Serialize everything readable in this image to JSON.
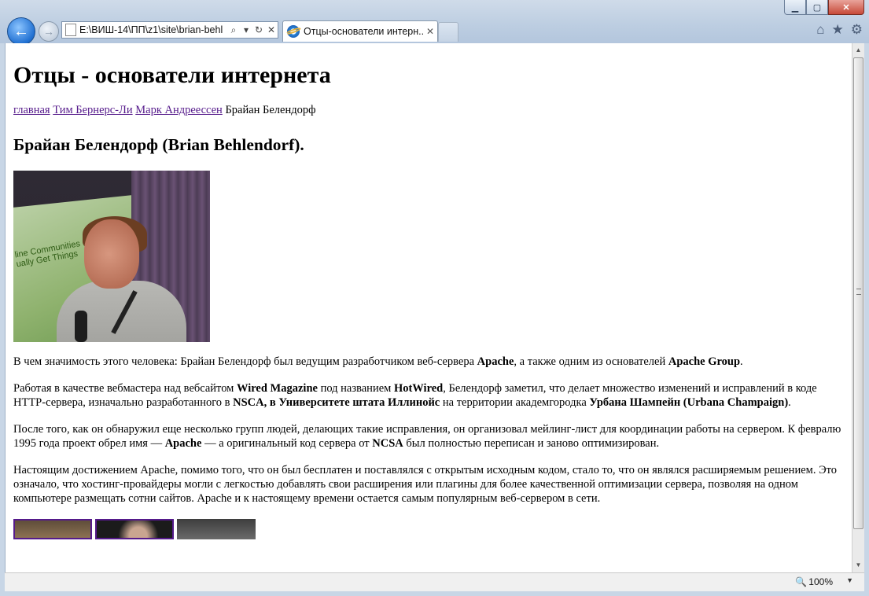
{
  "window": {
    "minimize_label": "▁",
    "maximize_label": "▢",
    "close_label": "✕"
  },
  "toolbar": {
    "back_icon": "back-arrow-icon",
    "forward_icon": "forward-arrow-icon",
    "address": "E:\\ВИШ-14\\ПП\\z1\\site\\brian-behl",
    "search_glyph": "⌕",
    "dropdown_glyph": "▾",
    "refresh_glyph": "↻",
    "stop_glyph": "✕"
  },
  "tab": {
    "title": "Отцы-основатели интерн...",
    "close_label": "✕"
  },
  "right_icons": {
    "home": "⌂",
    "favorites": "★",
    "tools": "⚙"
  },
  "page": {
    "title": "Отцы - основатели интернета",
    "nav": {
      "link1": "главная",
      "link2": "Тим Бернерс-Ли",
      "link3": "Марк Андреессен",
      "current": "Брайан Белендорф"
    },
    "subtitle": "Брайан Белендорф (Brian Behlendorf).",
    "slide_text": "line Communities\nually Get Things",
    "p1": {
      "a": "В чем значимость этого человека: Брайан Белендорф был ведущим разработчиком веб-сервера ",
      "b1": "Apache",
      "c": ", а также одним из основателей ",
      "b2": "Apache Group",
      "d": "."
    },
    "p2": {
      "a": "Работая в качестве вебмастера над вебсайтом ",
      "b1": "Wired Magazine",
      "c": " под названием ",
      "b2": "HotWired",
      "d": ", Белендорф заметил, что делает множество изменений и исправлений в коде HTTP-сервера, изначально разработанного в ",
      "b3": "NSCA, в Университете штата Иллинойс",
      "e": " на территории академгородка ",
      "b4": "Урбана Шампейн (Urbana Champaign)",
      "f": "."
    },
    "p3": {
      "a": "После того, как он обнаружил еще несколько групп людей, делающих такие исправления, он организовал мейлинг-лист для координации работы на сервером. К февралю 1995 года проект обрел имя — ",
      "b1": "Apache",
      "c": " — а оригинальный код сервера от ",
      "b2": "NCSA",
      "d": " был полностью переписан и заново оптимизирован."
    },
    "p4": "Настоящим достижением Apache, помимо того, что он был бесплатен и поставлялся с открытым исходным кодом, стало то, что он являлся расширяемым решением. Это означало, что хостинг-провайдеры могли с легкостью добавлять свои расширения или плагины для более качественной оптимизации сервера, позволяя на одном компьютере размещать сотни сайтов. Apache и к настоящему времени остается самым популярным веб-сервером в сети."
  },
  "statusbar": {
    "zoom": "100%",
    "zoom_icon": "zoom-icon"
  },
  "colors": {
    "visited_link": "#551a8b",
    "chrome": "#bccde1"
  }
}
